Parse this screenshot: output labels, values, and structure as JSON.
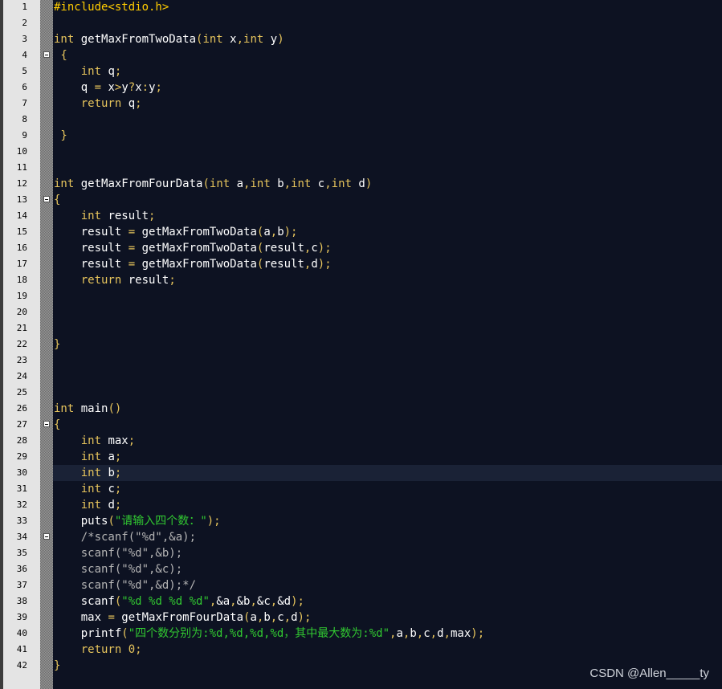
{
  "editor": {
    "active_line": 30,
    "fold_lines": [
      4,
      13,
      27,
      34
    ],
    "colors": {
      "background": "#0d1222",
      "gutter": "#e4e4e4",
      "preprocessor": "#ffcc00",
      "keyword": "#e6c45c",
      "identifier": "#ffffff",
      "string": "#31c831",
      "comment": "#b4b4b4"
    },
    "lines": [
      [
        [
          "pp",
          "#include<stdio.h>"
        ]
      ],
      [],
      [
        [
          "type",
          "int"
        ],
        [
          "id",
          " getMaxFromTwoData"
        ],
        [
          "op",
          "("
        ],
        [
          "type",
          "int"
        ],
        [
          "id",
          " x"
        ],
        [
          "op",
          ","
        ],
        [
          "type",
          "int"
        ],
        [
          "id",
          " y"
        ],
        [
          "op",
          ")"
        ]
      ],
      [
        [
          "op",
          " {"
        ]
      ],
      [
        [
          "id",
          "    "
        ],
        [
          "type",
          "int"
        ],
        [
          "id",
          " q"
        ],
        [
          "op",
          ";"
        ]
      ],
      [
        [
          "id",
          "    q "
        ],
        [
          "op",
          "="
        ],
        [
          "id",
          " x"
        ],
        [
          "op",
          ">"
        ],
        [
          "id",
          "y"
        ],
        [
          "op",
          "?"
        ],
        [
          "id",
          "x"
        ],
        [
          "op",
          ":"
        ],
        [
          "id",
          "y"
        ],
        [
          "op",
          ";"
        ]
      ],
      [
        [
          "id",
          "    "
        ],
        [
          "kw",
          "return"
        ],
        [
          "id",
          " q"
        ],
        [
          "op",
          ";"
        ]
      ],
      [],
      [
        [
          "op",
          " }"
        ]
      ],
      [],
      [],
      [
        [
          "type",
          "int"
        ],
        [
          "id",
          " getMaxFromFourData"
        ],
        [
          "op",
          "("
        ],
        [
          "type",
          "int"
        ],
        [
          "id",
          " a"
        ],
        [
          "op",
          ","
        ],
        [
          "type",
          "int"
        ],
        [
          "id",
          " b"
        ],
        [
          "op",
          ","
        ],
        [
          "type",
          "int"
        ],
        [
          "id",
          " c"
        ],
        [
          "op",
          ","
        ],
        [
          "type",
          "int"
        ],
        [
          "id",
          " d"
        ],
        [
          "op",
          ")"
        ]
      ],
      [
        [
          "op",
          "{"
        ]
      ],
      [
        [
          "id",
          "    "
        ],
        [
          "type",
          "int"
        ],
        [
          "id",
          " result"
        ],
        [
          "op",
          ";"
        ]
      ],
      [
        [
          "id",
          "    result "
        ],
        [
          "op",
          "="
        ],
        [
          "id",
          " getMaxFromTwoData"
        ],
        [
          "op",
          "("
        ],
        [
          "id",
          "a"
        ],
        [
          "op",
          ","
        ],
        [
          "id",
          "b"
        ],
        [
          "op",
          ");"
        ]
      ],
      [
        [
          "id",
          "    result "
        ],
        [
          "op",
          "="
        ],
        [
          "id",
          " getMaxFromTwoData"
        ],
        [
          "op",
          "("
        ],
        [
          "id",
          "result"
        ],
        [
          "op",
          ","
        ],
        [
          "id",
          "c"
        ],
        [
          "op",
          ");"
        ]
      ],
      [
        [
          "id",
          "    result "
        ],
        [
          "op",
          "="
        ],
        [
          "id",
          " getMaxFromTwoData"
        ],
        [
          "op",
          "("
        ],
        [
          "id",
          "result"
        ],
        [
          "op",
          ","
        ],
        [
          "id",
          "d"
        ],
        [
          "op",
          ");"
        ]
      ],
      [
        [
          "id",
          "    "
        ],
        [
          "kw",
          "return"
        ],
        [
          "id",
          " result"
        ],
        [
          "op",
          ";"
        ]
      ],
      [],
      [],
      [],
      [
        [
          "op",
          "}"
        ]
      ],
      [],
      [],
      [],
      [
        [
          "type",
          "int"
        ],
        [
          "id",
          " main"
        ],
        [
          "op",
          "()"
        ]
      ],
      [
        [
          "op",
          "{"
        ]
      ],
      [
        [
          "id",
          "    "
        ],
        [
          "type",
          "int"
        ],
        [
          "id",
          " max"
        ],
        [
          "op",
          ";"
        ]
      ],
      [
        [
          "id",
          "    "
        ],
        [
          "type",
          "int"
        ],
        [
          "id",
          " a"
        ],
        [
          "op",
          ";"
        ]
      ],
      [
        [
          "id",
          "    "
        ],
        [
          "type",
          "int"
        ],
        [
          "id",
          " b"
        ],
        [
          "op",
          ";"
        ]
      ],
      [
        [
          "id",
          "    "
        ],
        [
          "type",
          "int"
        ],
        [
          "id",
          " c"
        ],
        [
          "op",
          ";"
        ]
      ],
      [
        [
          "id",
          "    "
        ],
        [
          "type",
          "int"
        ],
        [
          "id",
          " d"
        ],
        [
          "op",
          ";"
        ]
      ],
      [
        [
          "id",
          "    puts"
        ],
        [
          "op",
          "("
        ],
        [
          "str",
          "\"请输入四个数："
        ],
        [
          "str",
          "\""
        ],
        [
          "op",
          ");"
        ]
      ],
      [
        [
          "cmt",
          "    /*scanf(\"%d\",&a);"
        ]
      ],
      [
        [
          "cmt",
          "    scanf(\"%d\",&b);"
        ]
      ],
      [
        [
          "cmt",
          "    scanf(\"%d\",&c);"
        ]
      ],
      [
        [
          "cmt",
          "    scanf(\"%d\",&d);*/"
        ]
      ],
      [
        [
          "id",
          "    scanf"
        ],
        [
          "op",
          "("
        ],
        [
          "str",
          "\"%d %d %d %d\""
        ],
        [
          "op",
          ","
        ],
        [
          "id",
          "&a"
        ],
        [
          "op",
          ","
        ],
        [
          "id",
          "&b"
        ],
        [
          "op",
          ","
        ],
        [
          "id",
          "&c"
        ],
        [
          "op",
          ","
        ],
        [
          "id",
          "&d"
        ],
        [
          "op",
          ");"
        ]
      ],
      [
        [
          "id",
          "    max "
        ],
        [
          "op",
          "="
        ],
        [
          "id",
          " getMaxFromFourData"
        ],
        [
          "op",
          "("
        ],
        [
          "id",
          "a"
        ],
        [
          "op",
          ","
        ],
        [
          "id",
          "b"
        ],
        [
          "op",
          ","
        ],
        [
          "id",
          "c"
        ],
        [
          "op",
          ","
        ],
        [
          "id",
          "d"
        ],
        [
          "op",
          ");"
        ]
      ],
      [
        [
          "id",
          "    printf"
        ],
        [
          "op",
          "("
        ],
        [
          "str",
          "\"四个数分别为:%d,%d,%d,%d，其中最大数为:%d\""
        ],
        [
          "op",
          ","
        ],
        [
          "id",
          "a"
        ],
        [
          "op",
          ","
        ],
        [
          "id",
          "b"
        ],
        [
          "op",
          ","
        ],
        [
          "id",
          "c"
        ],
        [
          "op",
          ","
        ],
        [
          "id",
          "d"
        ],
        [
          "op",
          ","
        ],
        [
          "id",
          "max"
        ],
        [
          "op",
          ");"
        ]
      ],
      [
        [
          "id",
          "    "
        ],
        [
          "kw",
          "return"
        ],
        [
          "id",
          " "
        ],
        [
          "num",
          "0"
        ],
        [
          "op",
          ";"
        ]
      ],
      [
        [
          "op",
          "}"
        ]
      ]
    ]
  },
  "watermark": "CSDN @Allen_____ty"
}
